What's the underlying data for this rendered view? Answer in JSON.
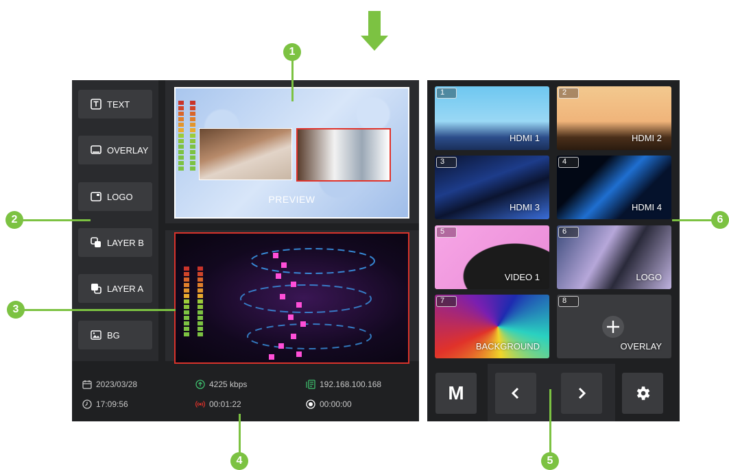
{
  "callouts": [
    "1",
    "2",
    "3",
    "4",
    "5",
    "6"
  ],
  "sidebar": {
    "items": [
      {
        "label": "TEXT",
        "icon": "text-icon"
      },
      {
        "label": "OVERLAY",
        "icon": "overlay-icon"
      },
      {
        "label": "LOGO",
        "icon": "logo-icon"
      },
      {
        "label": "LAYER B",
        "icon": "layer-b-icon"
      },
      {
        "label": "LAYER A",
        "icon": "layer-a-icon"
      },
      {
        "label": "BG",
        "icon": "image-icon"
      }
    ]
  },
  "preview": {
    "label": "PREVIEW"
  },
  "sources": [
    {
      "num": "1",
      "label": "HDMI 1"
    },
    {
      "num": "2",
      "label": "HDMI 2"
    },
    {
      "num": "3",
      "label": "HDMI 3"
    },
    {
      "num": "4",
      "label": "HDMI 4"
    },
    {
      "num": "5",
      "label": "VIDEO 1"
    },
    {
      "num": "6",
      "label": "LOGO"
    },
    {
      "num": "7",
      "label": "BACKGROUND"
    },
    {
      "num": "8",
      "label": "OVERLAY"
    }
  ],
  "status": {
    "date": "2023/03/28",
    "time": "17:09:56",
    "bitrate": "4225 kbps",
    "live_duration": "00:01:22",
    "ip": "192.168.100.168",
    "record_duration": "00:00:00"
  },
  "controls": {
    "m_label": "M"
  },
  "colors": {
    "accent": "#7cc242",
    "panel": "#1f2022",
    "button": "#3a3b3e",
    "program_border": "#d9332b",
    "live": "#e0322a"
  }
}
